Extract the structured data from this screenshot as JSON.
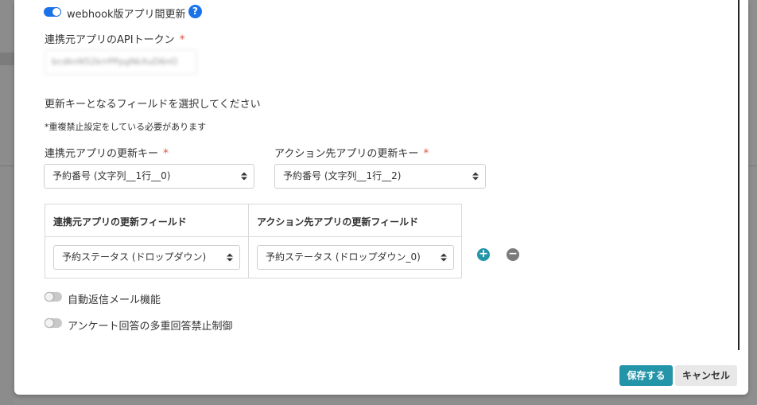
{
  "webhook": {
    "label": "webhook版アプリ間更新",
    "enabled": true,
    "help_icon": "question-circle-icon"
  },
  "token": {
    "label": "連携元アプリのAPIトークン",
    "value": "bcdknN52krrPPpgNkXuD6nO"
  },
  "update_key": {
    "heading": "更新キーとなるフィールドを選択してください",
    "note": "*重複禁止設定をしている必要があります",
    "source_label": "連携元アプリの更新キー",
    "source_value": "予約番号 (文字列__1行__0)",
    "target_label": "アクション先アプリの更新キー",
    "target_value": "予約番号 (文字列__1行__2)"
  },
  "fields_table": {
    "headers": [
      "連携元アプリの更新フィールド",
      "アクション先アプリの更新フィールド"
    ],
    "rows": [
      {
        "source": "予約ステータス (ドロップダウン)",
        "target": "予約ステータス (ドロップダウン_0)"
      }
    ],
    "add_icon": "plus-circle-icon",
    "remove_icon": "minus-circle-icon",
    "add_color": "#2494a8",
    "remove_color": "#7a7a7a"
  },
  "options": {
    "auto_reply": {
      "label": "自動返信メール機能",
      "enabled": false
    },
    "survey_limit": {
      "label": "アンケート回答の多重回答禁止制御",
      "enabled": false
    }
  },
  "footer": {
    "save_label": "保存する",
    "cancel_label": "キャンセル"
  },
  "colors": {
    "accent": "#1a73e8",
    "primary_button": "#2494a8",
    "required": "#e0584a"
  }
}
